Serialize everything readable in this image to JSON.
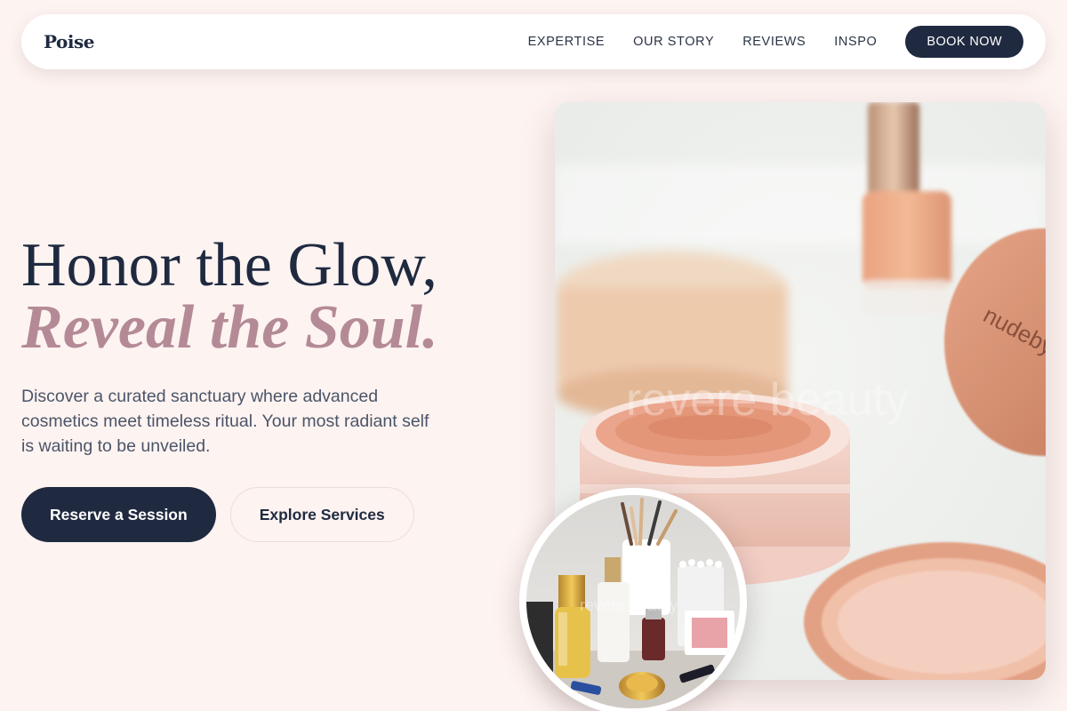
{
  "brand": {
    "name": "Poise"
  },
  "nav": {
    "links": [
      "EXPERTISE",
      "OUR STORY",
      "REVIEWS",
      "INSPO"
    ],
    "cta_label": "BOOK NOW"
  },
  "hero": {
    "headline_line1": "Honor the Glow,",
    "headline_line2": "Reveal the Soul.",
    "lead": "Discover a curated sanctuary where advanced cosmetics meet timeless ritual. Your most radiant self is waiting to be unveiled.",
    "primary_cta": "Reserve a Session",
    "secondary_cta": "Explore Services"
  },
  "images": {
    "main_alt": "Loose powder jars and foundation bottle",
    "main_watermark": "revere beauty",
    "main_jar_label": "nudeby",
    "circle_alt": "Makeup brushes, serums and cosmetics collection",
    "circle_watermark": "revere beauty"
  },
  "colors": {
    "background": "#fdf3f1",
    "navy": "#1f2a40",
    "mauve": "#b48a96",
    "body_text": "#4b5568"
  }
}
